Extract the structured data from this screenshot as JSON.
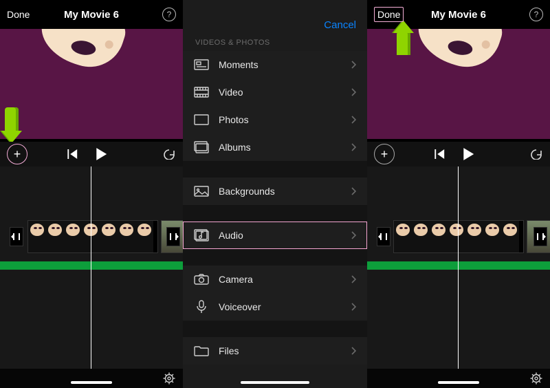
{
  "panel1": {
    "done": "Done",
    "title": "My Movie 6"
  },
  "panel2": {
    "cancel": "Cancel",
    "section": "VIDEOS & PHOTOS",
    "items": {
      "moments": "Moments",
      "video": "Video",
      "photos": "Photos",
      "albums": "Albums",
      "backgrounds": "Backgrounds",
      "audio": "Audio",
      "camera": "Camera",
      "voiceover": "Voiceover",
      "files": "Files"
    }
  },
  "panel3": {
    "done": "Done",
    "title": "My Movie 6"
  }
}
